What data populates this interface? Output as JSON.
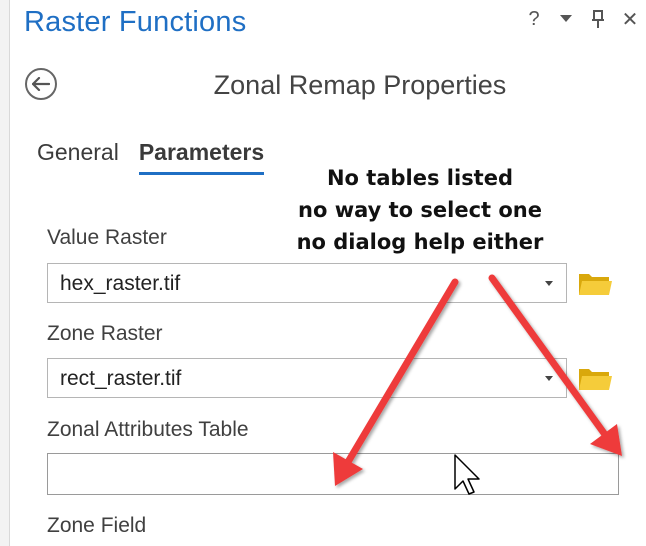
{
  "pane": {
    "title": "Raster Functions",
    "controls": {
      "help": "?",
      "menu_icon": "chevron-down-icon",
      "pin_icon": "pin-icon",
      "close": "✕"
    }
  },
  "dialog": {
    "back_icon": "back-arrow-icon",
    "title": "Zonal Remap Properties"
  },
  "tabs": [
    {
      "label": "General",
      "active": false
    },
    {
      "label": "Parameters",
      "active": true
    }
  ],
  "parameters": {
    "value_raster": {
      "label": "Value Raster",
      "value": "hex_raster.tif"
    },
    "zone_raster": {
      "label": "Zone Raster",
      "value": "rect_raster.tif"
    },
    "zonal_attributes_table": {
      "label": "Zonal Attributes Table",
      "value": ""
    },
    "zone_field": {
      "label": "Zone Field"
    }
  },
  "annotation": {
    "lines": [
      "No tables listed",
      "no way to select one",
      "no dialog help either"
    ],
    "arrow_color": "#ee3b3b"
  },
  "colors": {
    "accent": "#1f6fc4",
    "folder": "#f0c419",
    "arrow": "#ee3b3b"
  }
}
